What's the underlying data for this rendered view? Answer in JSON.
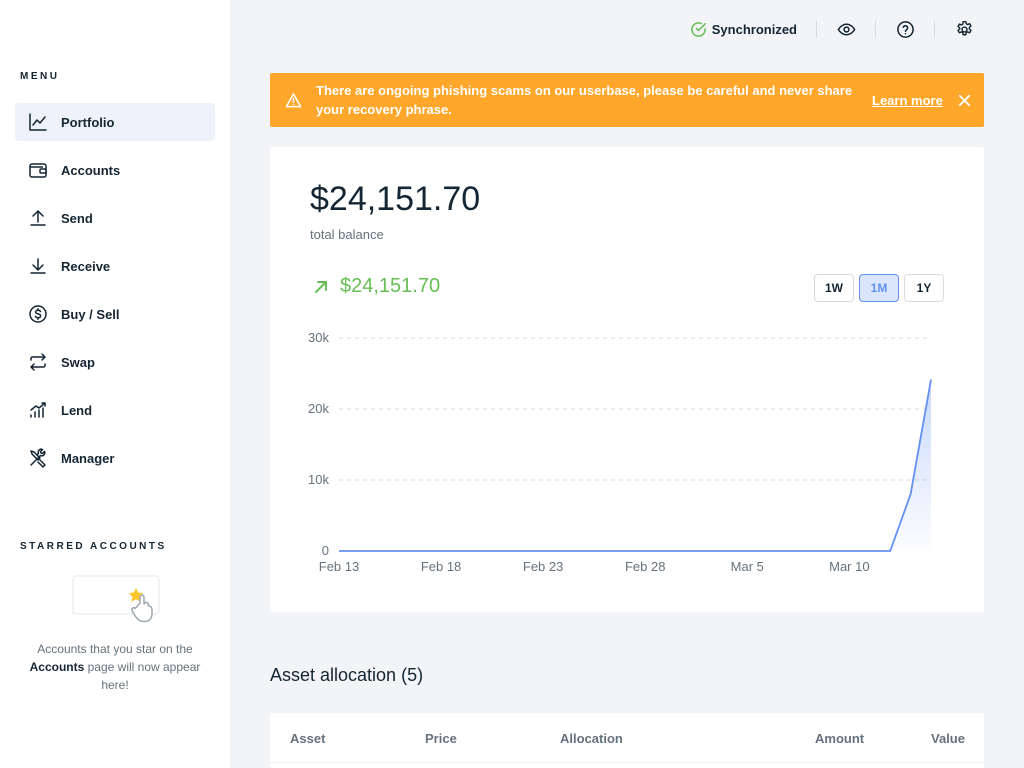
{
  "sidebar": {
    "menu_title": "MENU",
    "items": [
      {
        "label": "Portfolio",
        "icon": "chart-line-icon",
        "active": true
      },
      {
        "label": "Accounts",
        "icon": "wallet-icon"
      },
      {
        "label": "Send",
        "icon": "arrow-up-icon"
      },
      {
        "label": "Receive",
        "icon": "arrow-down-icon"
      },
      {
        "label": "Buy / Sell",
        "icon": "dollar-coin-icon"
      },
      {
        "label": "Swap",
        "icon": "swap-arrows-icon"
      },
      {
        "label": "Lend",
        "icon": "lend-chart-icon"
      },
      {
        "label": "Manager",
        "icon": "tools-icon"
      }
    ],
    "starred": {
      "title": "STARRED ACCOUNTS",
      "text_before": "Accounts that you star on the ",
      "text_bold": "Accounts",
      "text_after": " page will now appear here!"
    }
  },
  "topbar": {
    "sync_label": "Synchronized",
    "icons": [
      "eye-icon",
      "help-icon",
      "settings-icon"
    ]
  },
  "banner": {
    "message": "There are ongoing phishing scams on our userbase, please be careful and never share your recovery phrase.",
    "link": "Learn more",
    "color": "#ffa72b"
  },
  "balance": {
    "total": "$24,151.70",
    "subtitle": "total balance",
    "delta": "$24,151.70",
    "ranges": [
      "1W",
      "1M",
      "1Y"
    ],
    "selected_range": "1M"
  },
  "chart_data": {
    "type": "area",
    "x": [
      "Feb 13",
      "Feb 14",
      "Feb 15",
      "Feb 16",
      "Feb 17",
      "Feb 18",
      "Feb 19",
      "Feb 20",
      "Feb 21",
      "Feb 22",
      "Feb 23",
      "Feb 24",
      "Feb 25",
      "Feb 26",
      "Feb 27",
      "Feb 28",
      "Mar 1",
      "Mar 2",
      "Mar 3",
      "Mar 4",
      "Mar 5",
      "Mar 6",
      "Mar 7",
      "Mar 8",
      "Mar 9",
      "Mar 10",
      "Mar 11",
      "Mar 12",
      "Mar 13",
      "Mar 14"
    ],
    "values": [
      0,
      0,
      0,
      0,
      0,
      0,
      0,
      0,
      0,
      0,
      0,
      0,
      0,
      0,
      0,
      0,
      0,
      0,
      0,
      0,
      0,
      0,
      0,
      0,
      0,
      0,
      0,
      0,
      8000,
      24151.7
    ],
    "x_tick_labels": [
      "Feb 13",
      "Feb 18",
      "Feb 23",
      "Feb 28",
      "Mar 5",
      "Mar 10"
    ],
    "y_ticks": [
      0,
      10000,
      20000,
      30000
    ],
    "y_tick_labels": [
      "0",
      "10k",
      "20k",
      "30k"
    ],
    "ylim": [
      0,
      30000
    ],
    "grid": true,
    "color": "#6490f1"
  },
  "allocation": {
    "title": "Asset allocation (5)",
    "columns": [
      "Asset",
      "Price",
      "Allocation",
      "Amount",
      "Value"
    ]
  }
}
